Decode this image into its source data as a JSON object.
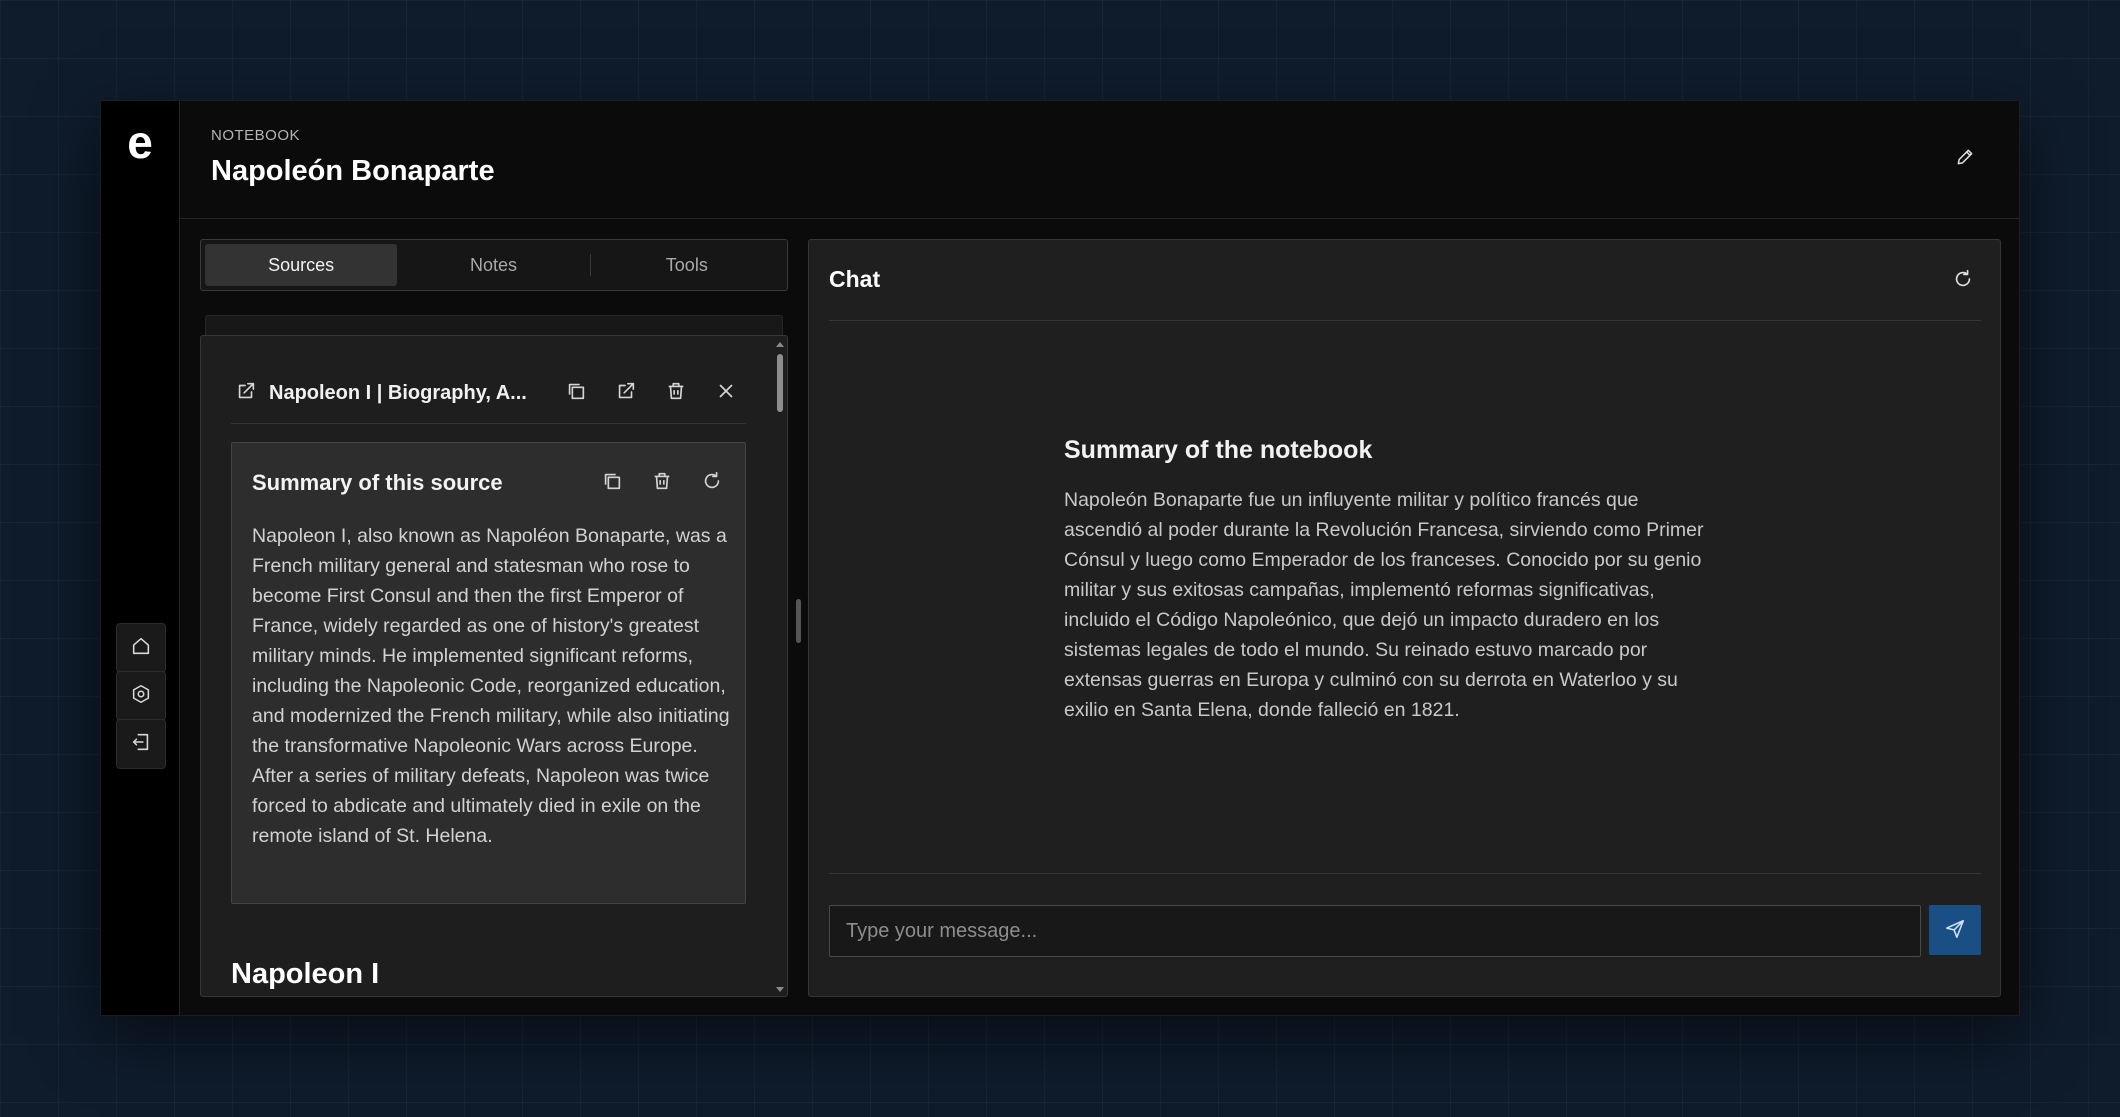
{
  "app": {
    "logo": "e"
  },
  "rail": {
    "items": [
      {
        "name": "home",
        "icon": "home-icon"
      },
      {
        "name": "settings",
        "icon": "gear-icon"
      },
      {
        "name": "logout",
        "icon": "logout-icon"
      }
    ]
  },
  "header": {
    "eyebrow": "NOTEBOOK",
    "title": "Napoleón Bonaparte",
    "edit_icon": "pencil-icon"
  },
  "tabs": [
    {
      "label": "Sources",
      "active": true
    },
    {
      "label": "Notes",
      "active": false
    },
    {
      "label": "Tools",
      "active": false
    }
  ],
  "source": {
    "title": "Napoleon I | Biography, A...",
    "link_icon": "external-link-icon",
    "actions": [
      "copy-icon",
      "external-link-icon",
      "trash-icon",
      "close-icon"
    ],
    "summary_card": {
      "title": "Summary of this source",
      "actions": [
        "copy-icon",
        "trash-icon",
        "refresh-icon"
      ],
      "text": "Napoleon I, also known as Napoléon Bonaparte, was a French military general and statesman who rose to become First Consul and then the first Emperor of France, widely regarded as one of history's greatest military minds. He implemented significant reforms, including the Napoleonic Code, reorganized education, and modernized the French military, while also initiating the transformative Napoleonic Wars across Europe. After a series of military defeats, Napoleon was twice forced to abdicate and ultimately died in exile on the remote island of St. Helena."
    },
    "heading": "Napoleon I"
  },
  "chat": {
    "title": "Chat",
    "refresh_icon": "refresh-icon",
    "summary_title": "Summary of the notebook",
    "summary_text": "Napoleón Bonaparte fue un influyente militar y político francés que ascendió al poder durante la Revolución Francesa, sirviendo como Primer Cónsul y luego como Emperador de los franceses. Conocido por su genio militar y sus exitosas campañas, implementó reformas significativas, incluido el Código Napoleónico, que dejó un impacto duradero en los sistemas legales de todo el mundo. Su reinado estuvo marcado por extensas guerras en Europa y culminó con su derrota en Waterloo y su exilio en Santa Elena, donde falleció en 1821.",
    "input_placeholder": "Type your message...",
    "input_value": "",
    "send_icon": "send-icon"
  },
  "colors": {
    "background": "#0f1c2c",
    "panel": "#1f1f1f",
    "accent": "#1a4f86"
  }
}
